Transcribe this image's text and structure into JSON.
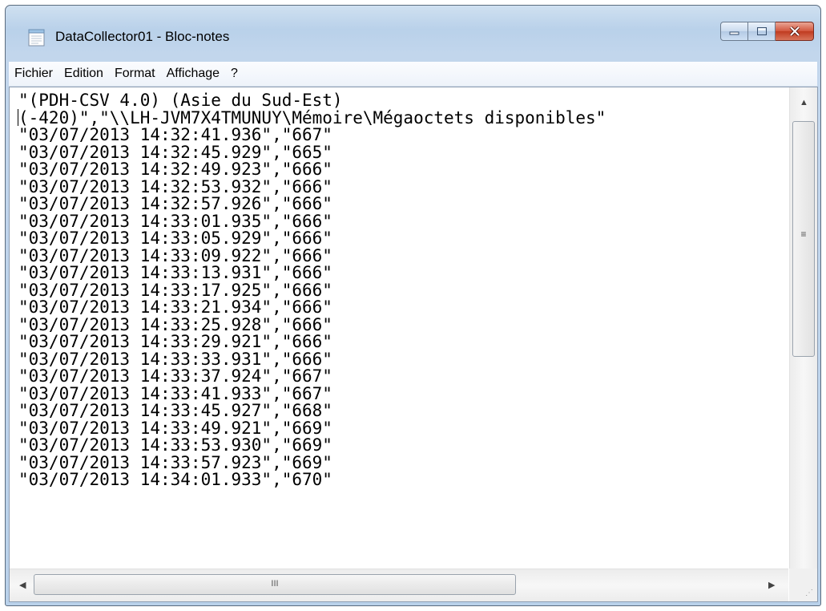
{
  "window": {
    "title": "DataCollector01 - Bloc-notes",
    "minimize_glyph": "–",
    "maximize_glyph": "□",
    "close_glyph": "✕"
  },
  "menu": {
    "items": [
      "Fichier",
      "Edition",
      "Format",
      "Affichage",
      "?"
    ]
  },
  "document": {
    "lines": [
      "\"(PDH-CSV 4.0) (Asie du Sud-Est)",
      "(-420)\",\"\\\\LH-JVM7X4TMUNUY\\Mémoire\\Mégaoctets disponibles\"",
      "\"03/07/2013 14:32:41.936\",\"667\"",
      "\"03/07/2013 14:32:45.929\",\"665\"",
      "\"03/07/2013 14:32:49.923\",\"666\"",
      "\"03/07/2013 14:32:53.932\",\"666\"",
      "\"03/07/2013 14:32:57.926\",\"666\"",
      "\"03/07/2013 14:33:01.935\",\"666\"",
      "\"03/07/2013 14:33:05.929\",\"666\"",
      "\"03/07/2013 14:33:09.922\",\"666\"",
      "\"03/07/2013 14:33:13.931\",\"666\"",
      "\"03/07/2013 14:33:17.925\",\"666\"",
      "\"03/07/2013 14:33:21.934\",\"666\"",
      "\"03/07/2013 14:33:25.928\",\"666\"",
      "\"03/07/2013 14:33:29.921\",\"666\"",
      "\"03/07/2013 14:33:33.931\",\"666\"",
      "\"03/07/2013 14:33:37.924\",\"667\"",
      "\"03/07/2013 14:33:41.933\",\"667\"",
      "\"03/07/2013 14:33:45.927\",\"668\"",
      "\"03/07/2013 14:33:49.921\",\"669\"",
      "\"03/07/2013 14:33:53.930\",\"669\"",
      "\"03/07/2013 14:33:57.923\",\"669\"",
      "\"03/07/2013 14:34:01.933\",\"670\""
    ]
  },
  "scrollbars": {
    "vertical_grip": "≡",
    "horizontal_grip": "III",
    "up_arrow": "▲",
    "down_arrow": "▼",
    "left_arrow": "◀",
    "right_arrow": "▶",
    "resize_glyph": "⋰"
  }
}
